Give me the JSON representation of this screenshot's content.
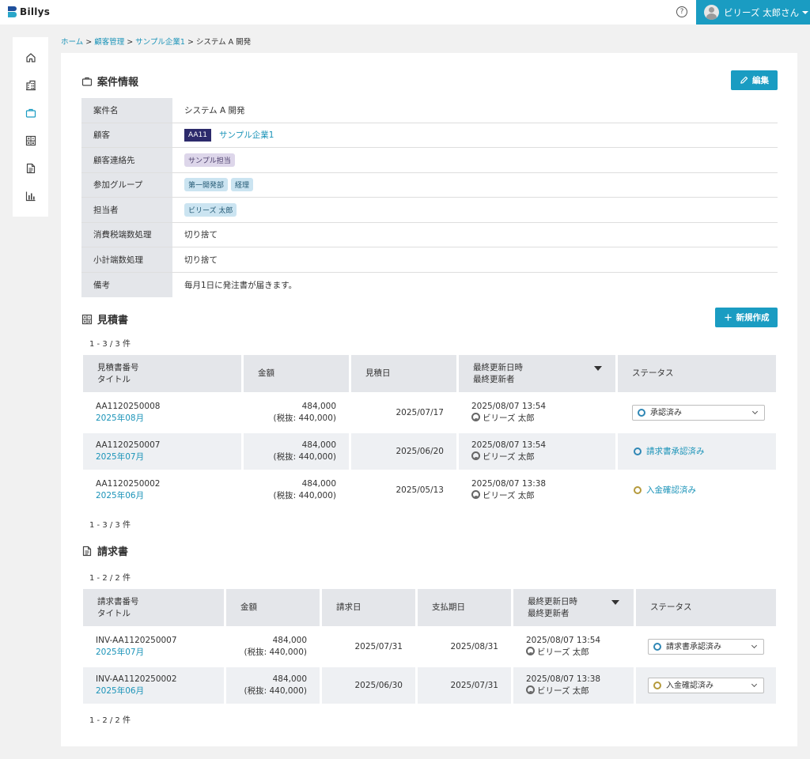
{
  "app": {
    "logo_text": "Billys"
  },
  "header": {
    "help_label": "?",
    "user_name": "ビリーズ 太郎さん"
  },
  "sidebar": {
    "items": [
      {
        "name": "home-icon",
        "active": false
      },
      {
        "name": "building-icon",
        "active": false
      },
      {
        "name": "briefcase-icon",
        "active": true
      },
      {
        "name": "calculator-icon",
        "active": false
      },
      {
        "name": "document-icon",
        "active": false
      },
      {
        "name": "bar-chart-icon",
        "active": false
      }
    ]
  },
  "breadcrumb": {
    "home": "ホーム",
    "customers": "顧客管理",
    "company": "サンプル企業1",
    "current": "システム A 開発",
    "sep": ">"
  },
  "project": {
    "title": "案件情報",
    "edit_label": "編集",
    "rows": {
      "name": {
        "label": "案件名",
        "value": "システム A 開発"
      },
      "customer": {
        "label": "顧客",
        "code": "AA11",
        "value": "サンプル企業1"
      },
      "contact": {
        "label": "顧客連絡先",
        "tag": "サンプル担当"
      },
      "groups": {
        "label": "参加グループ",
        "tags": [
          "第一開発部",
          "経理"
        ]
      },
      "owner": {
        "label": "担当者",
        "tag": "ビリーズ 太郎"
      },
      "tax": {
        "label": "消費税端数処理",
        "value": "切り捨て"
      },
      "subtotal": {
        "label": "小計端数処理",
        "value": "切り捨て"
      },
      "note": {
        "label": "備考",
        "value": "毎月1日に発注書が届きます。"
      }
    }
  },
  "estimates": {
    "title": "見積書",
    "new_label": "新規作成",
    "count": "1 - 3 / 3 件",
    "headers": {
      "number": "見積書番号",
      "title": "タイトル",
      "amount": "金額",
      "date": "見積日",
      "updated": "最終更新日時",
      "updater": "最終更新者",
      "status": "ステータス"
    },
    "rows": [
      {
        "number": "AA1120250008",
        "title": "2025年08月",
        "amount": "484,000",
        "tax": "(税抜: 440,000)",
        "date": "2025/07/17",
        "updated": "2025/08/07 13:54",
        "updater": "ビリーズ 太郎",
        "status": "承認済み",
        "status_kind": "select",
        "status_color": "#2f87b5"
      },
      {
        "number": "AA1120250007",
        "title": "2025年07月",
        "amount": "484,000",
        "tax": "(税抜: 440,000)",
        "date": "2025/06/20",
        "updated": "2025/08/07 13:54",
        "updater": "ビリーズ 太郎",
        "status": "請求書承認済み",
        "status_kind": "text",
        "status_color": "#2f87b5"
      },
      {
        "number": "AA1120250002",
        "title": "2025年06月",
        "amount": "484,000",
        "tax": "(税抜: 440,000)",
        "date": "2025/05/13",
        "updated": "2025/08/07 13:38",
        "updater": "ビリーズ 太郎",
        "status": "入金確認済み",
        "status_kind": "text",
        "status_color": "#b59a3c"
      }
    ]
  },
  "invoices": {
    "title": "請求書",
    "count": "1 - 2 / 2 件",
    "headers": {
      "number": "請求書番号",
      "title": "タイトル",
      "amount": "金額",
      "date": "請求日",
      "due": "支払期日",
      "updated": "最終更新日時",
      "updater": "最終更新者",
      "status": "ステータス"
    },
    "rows": [
      {
        "number": "INV-AA1120250007",
        "title": "2025年07月",
        "amount": "484,000",
        "tax": "(税抜: 440,000)",
        "date": "2025/07/31",
        "due": "2025/08/31",
        "updated": "2025/08/07 13:54",
        "updater": "ビリーズ 太郎",
        "status": "請求書承認済み",
        "status_color": "#2f87b5"
      },
      {
        "number": "INV-AA1120250002",
        "title": "2025年06月",
        "amount": "484,000",
        "tax": "(税抜: 440,000)",
        "date": "2025/06/30",
        "due": "2025/07/31",
        "updated": "2025/08/07 13:38",
        "updater": "ビリーズ 太郎",
        "status": "入金確認済み",
        "status_color": "#b59a3c"
      }
    ]
  },
  "colors": {
    "accent": "#1a9cc2",
    "link": "#1a93b8",
    "header_cell": "#e4e6ea",
    "dark_tag": "#2c2a6b"
  }
}
